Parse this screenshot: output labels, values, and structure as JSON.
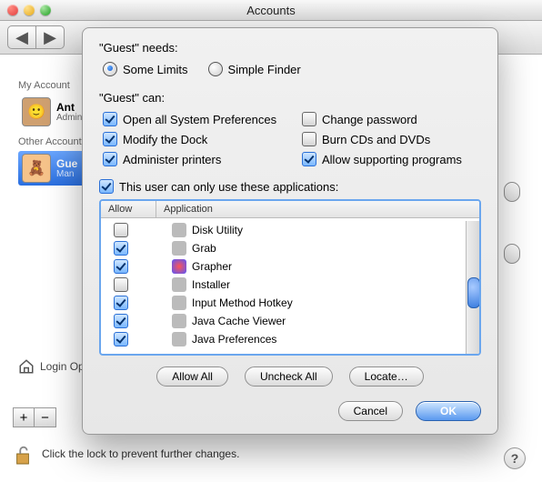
{
  "window": {
    "title": "Accounts"
  },
  "sidebar": {
    "my_account_label": "My Account",
    "other_accounts_label": "Other Accounts",
    "user1": {
      "name": "Ant",
      "role": "Admin"
    },
    "user2": {
      "name": "Gue",
      "role": "Man"
    },
    "login_options_label": "Login Options"
  },
  "footer": {
    "plus": "+",
    "minus": "−",
    "lock_text": "Click the lock to prevent further changes.",
    "help": "?"
  },
  "sheet": {
    "needs_label": "\"Guest\" needs:",
    "radio_some_limits": "Some Limits",
    "radio_simple_finder": "Simple Finder",
    "can_label": "\"Guest\" can:",
    "caps": {
      "open_prefs": "Open all System Preferences",
      "modify_dock": "Modify the Dock",
      "admin_printers": "Administer printers",
      "change_password": "Change password",
      "burn": "Burn CDs and DVDs",
      "allow_supporting": "Allow supporting programs"
    },
    "only_apps_label": "This user can only use these applications:",
    "cols": {
      "allow": "Allow",
      "application": "Application"
    },
    "apps": [
      {
        "label": "Disk Utility",
        "checked": false
      },
      {
        "label": "Grab",
        "checked": true
      },
      {
        "label": "Grapher",
        "checked": true
      },
      {
        "label": "Installer",
        "checked": false
      },
      {
        "label": "Input Method Hotkey",
        "checked": true
      },
      {
        "label": "Java Cache Viewer",
        "checked": true
      },
      {
        "label": "Java Preferences",
        "checked": true
      }
    ],
    "btn_allow_all": "Allow All",
    "btn_uncheck_all": "Uncheck All",
    "btn_locate": "Locate…",
    "btn_cancel": "Cancel",
    "btn_ok": "OK"
  }
}
